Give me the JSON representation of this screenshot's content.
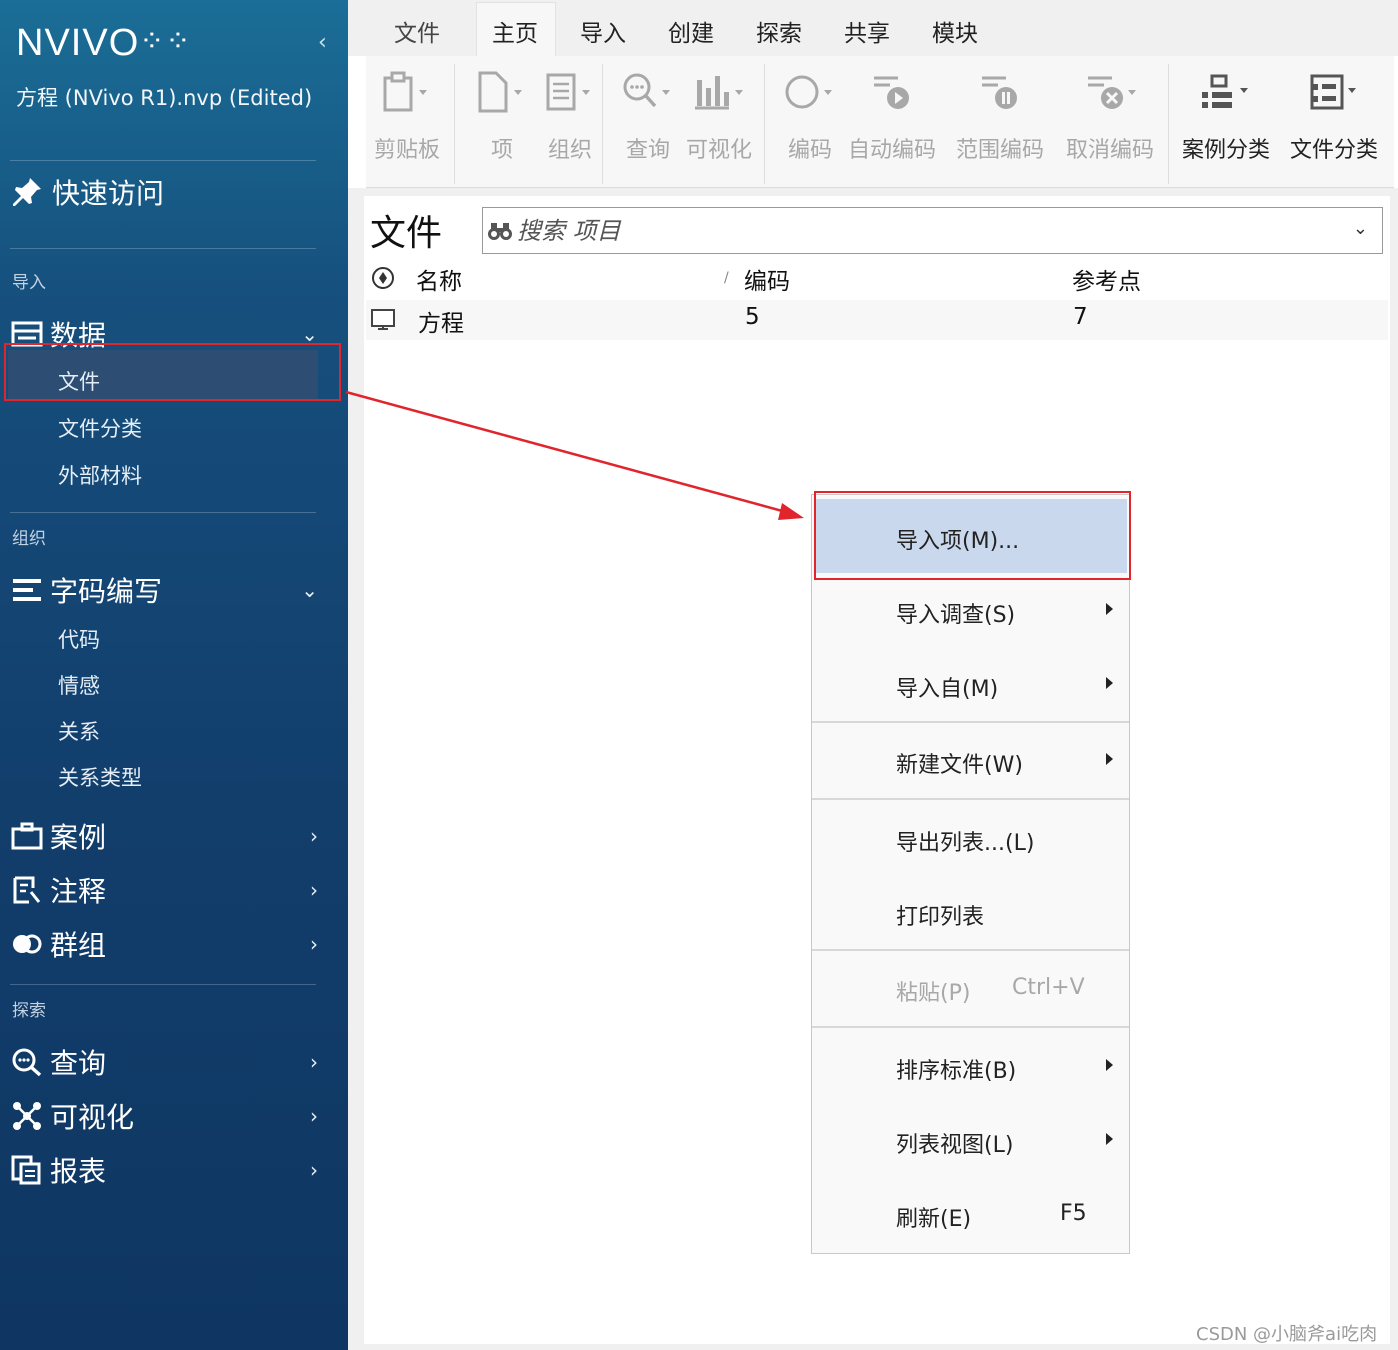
{
  "sidebar": {
    "logo": "NVIVO",
    "logo_dots": "⁘⁘",
    "project_name": "方程 (NVivo R1).nvp (Edited)",
    "quick_access": "快速访问",
    "sections": {
      "import": "导入",
      "organize": "组织",
      "explore": "探索"
    },
    "data_group": {
      "label": "数据",
      "items": [
        "文件",
        "文件分类",
        "外部材料"
      ]
    },
    "coding_group": {
      "label": "字码编写",
      "items": [
        "代码",
        "情感",
        "关系",
        "关系类型"
      ]
    },
    "cases": "案例",
    "notes": "注释",
    "groups": "群组",
    "queries": "查询",
    "visualization": "可视化",
    "reports": "报表"
  },
  "ribbon": {
    "tabs": [
      "文件",
      "主页",
      "导入",
      "创建",
      "探索",
      "共享",
      "模块"
    ],
    "active_tab": "主页",
    "buttons": [
      "剪贴板",
      "项",
      "组织",
      "查询",
      "可视化",
      "编码",
      "自动编码",
      "范围编码",
      "取消编码",
      "案例分类",
      "文件分类"
    ]
  },
  "main": {
    "title": "文件",
    "search_placeholder": "搜索 项目",
    "columns": [
      "名称",
      "编码",
      "参考点"
    ],
    "rows": [
      {
        "name": "方程",
        "codes": "5",
        "references": "7"
      }
    ]
  },
  "context_menu": {
    "items": [
      {
        "label": "导入项(M)...",
        "submenu": false,
        "highlighted": true
      },
      {
        "label": "导入调查(S)",
        "submenu": true
      },
      {
        "label": "导入自(M)",
        "submenu": true
      },
      {
        "label": "新建文件(W)",
        "submenu": true
      },
      {
        "label": "导出列表...(L)",
        "submenu": false
      },
      {
        "label": "打印列表",
        "submenu": false
      },
      {
        "label": "粘贴(P)",
        "shortcut": "Ctrl+V",
        "disabled": true
      },
      {
        "label": "排序标准(B)",
        "submenu": true
      },
      {
        "label": "列表视图(L)",
        "submenu": true
      },
      {
        "label": "刷新(E)",
        "shortcut": "F5"
      }
    ]
  },
  "watermark": "CSDN @小脑斧ai吃肉",
  "colors": {
    "sidebar": "#164f7d",
    "highlight": "#cad8ee",
    "annotation": "#e0252c"
  }
}
